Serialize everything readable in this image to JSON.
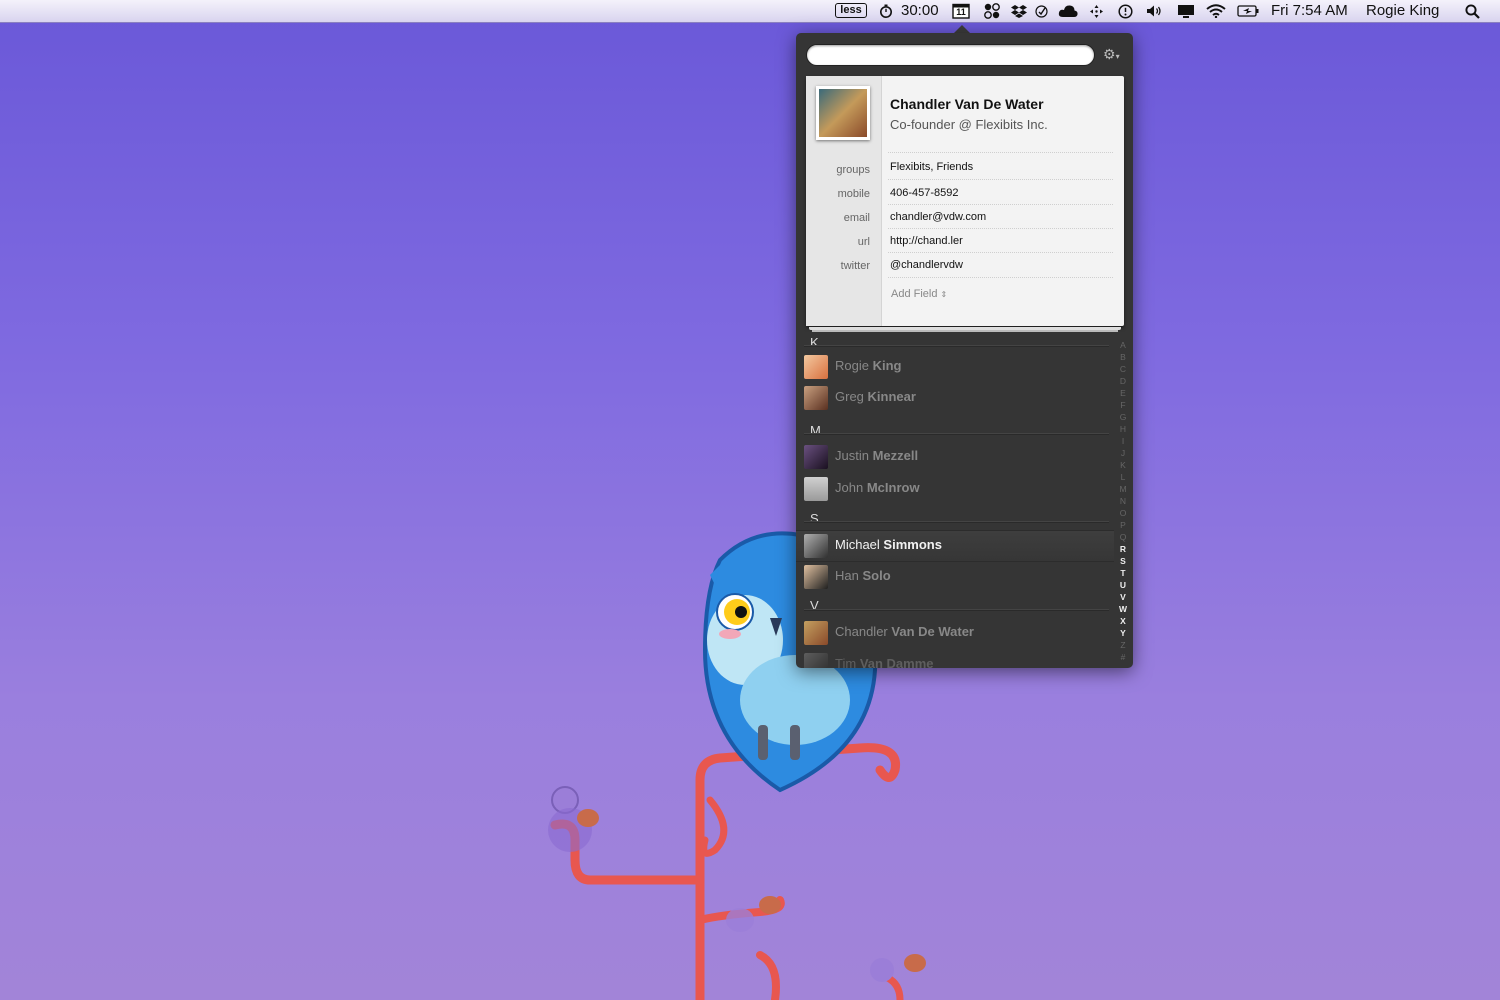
{
  "menubar": {
    "less_badge": "less",
    "timer": "30:00",
    "calendar_day": "11",
    "clock": "Fri 7:54 AM",
    "user": "Rogie King",
    "icons": [
      "stopwatch-icon",
      "calendar-icon",
      "grid-apps-icon",
      "dropbox-icon",
      "checkmark-icon",
      "cloud-icon",
      "move-icon",
      "time-machine-icon",
      "volume-icon",
      "display-icon",
      "wifi-icon",
      "battery-icon",
      "spotlight-icon"
    ]
  },
  "popover": {
    "search": {
      "placeholder": "",
      "value": ""
    },
    "card": {
      "name": "Chandler Van De Water",
      "title": "Co-founder @ Flexibits Inc.",
      "fields": [
        {
          "label": "groups",
          "value": "Flexibits, Friends"
        },
        {
          "label": "mobile",
          "value": "406-457-8592"
        },
        {
          "label": "email",
          "value": "chandler@vdw.com"
        },
        {
          "label": "url",
          "value": "http://chand.ler"
        },
        {
          "label": "twitter",
          "value": "@chandlervdw"
        }
      ],
      "add_field": "Add Field"
    },
    "sections": [
      {
        "letter": "K",
        "contacts": [
          {
            "first": "Rogie",
            "last": "King"
          },
          {
            "first": "Greg",
            "last": "Kinnear"
          }
        ]
      },
      {
        "letter": "M",
        "contacts": [
          {
            "first": "Justin",
            "last": "Mezzell"
          },
          {
            "first": "John",
            "last": "McInrow"
          }
        ]
      },
      {
        "letter": "S",
        "contacts": [
          {
            "first": "Michael",
            "last": "Simmons",
            "selected": true
          },
          {
            "first": "Han",
            "last": "Solo"
          }
        ]
      },
      {
        "letter": "V",
        "contacts": [
          {
            "first": "Chandler",
            "last": "Van De Water"
          },
          {
            "first": "Tim",
            "last": "Van Damme"
          }
        ]
      }
    ],
    "index_letters": [
      "A",
      "B",
      "C",
      "D",
      "E",
      "F",
      "G",
      "H",
      "I",
      "J",
      "K",
      "L",
      "M",
      "N",
      "O",
      "P",
      "Q",
      "R",
      "S",
      "T",
      "U",
      "V",
      "W",
      "X",
      "Y",
      "Z",
      "#"
    ],
    "index_active": [
      "R",
      "S",
      "T",
      "U",
      "V",
      "W",
      "X",
      "Y"
    ]
  },
  "colors": {
    "desktop_top": "#6a58d8",
    "desktop_bottom": "#a284d8",
    "popover_bg": "#353535",
    "owl_blue": "#2d8be0",
    "branch_red": "#e8574f"
  }
}
